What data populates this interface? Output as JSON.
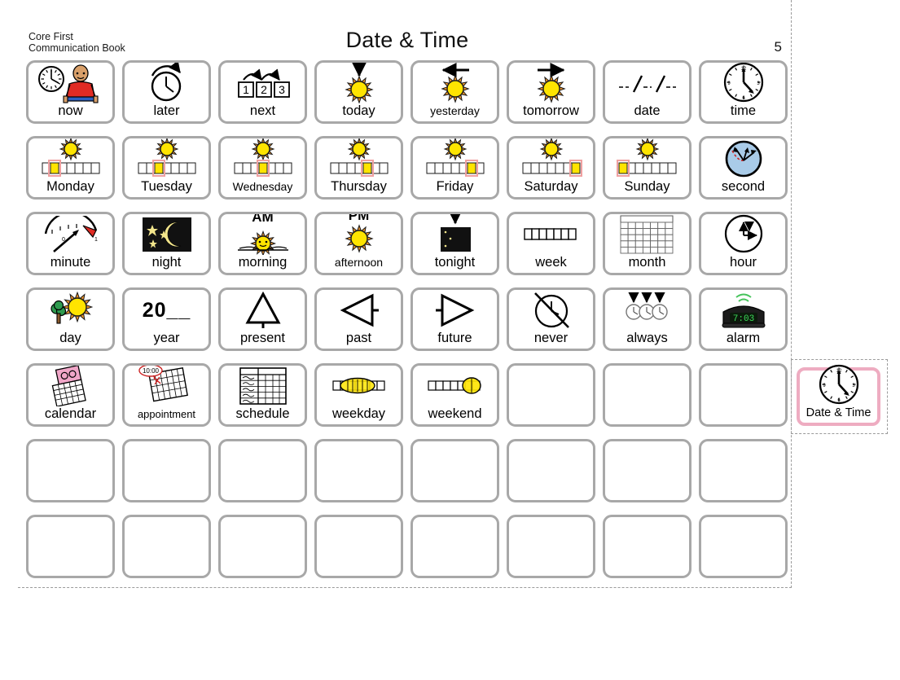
{
  "header": {
    "book_label": "Core First\nCommunication Book",
    "title": "Date & Time",
    "page_number": "5"
  },
  "tab": {
    "label": "Date & Time",
    "icon": "clock-icon",
    "border_color": "#eeacc1"
  },
  "colors": {
    "cell_border": "#a8a8a8",
    "sun_yellow": "#ffe400",
    "sun_orange": "#e8912c",
    "tab_pink": "#eeacc1",
    "second_blue": "#a9cbe8",
    "alarm_green": "#3ddc5a"
  },
  "grid": {
    "columns": 8,
    "rows": 7,
    "cells": [
      {
        "label": "now",
        "icon": "person-with-clock-icon"
      },
      {
        "label": "later",
        "icon": "clock-arrow-forward-icon"
      },
      {
        "label": "next",
        "icon": "numbered-boxes-icon",
        "numbers": [
          "1",
          "2",
          "3"
        ]
      },
      {
        "label": "today",
        "icon": "sun-down-arrow-icon"
      },
      {
        "label": "yesterday",
        "icon": "sun-left-arrow-icon"
      },
      {
        "label": "tomorrow",
        "icon": "sun-right-arrow-icon"
      },
      {
        "label": "date",
        "icon": "date-slashes-icon"
      },
      {
        "label": "time",
        "icon": "clock-face-icon"
      },
      {
        "label": "Monday",
        "icon": "week-bar-sun-icon",
        "highlight_day": 2
      },
      {
        "label": "Tuesday",
        "icon": "week-bar-sun-icon",
        "highlight_day": 3
      },
      {
        "label": "Wednesday",
        "icon": "week-bar-sun-icon",
        "highlight_day": 4
      },
      {
        "label": "Thursday",
        "icon": "week-bar-sun-icon",
        "highlight_day": 5
      },
      {
        "label": "Friday",
        "icon": "week-bar-sun-icon",
        "highlight_day": 6
      },
      {
        "label": "Saturday",
        "icon": "week-bar-sun-icon",
        "highlight_day": 7
      },
      {
        "label": "Sunday",
        "icon": "week-bar-sun-icon",
        "highlight_day": 1
      },
      {
        "label": "second",
        "icon": "second-hand-dial-icon"
      },
      {
        "label": "minute",
        "icon": "gauge-needle-icon"
      },
      {
        "label": "night",
        "icon": "moon-stars-icon"
      },
      {
        "label": "morning",
        "icon": "sunrise-icon",
        "caption": "AM"
      },
      {
        "label": "afternoon",
        "icon": "sun-icon",
        "caption": "PM"
      },
      {
        "label": "tonight",
        "icon": "moon-down-arrow-icon"
      },
      {
        "label": "week",
        "icon": "week-bar-icon"
      },
      {
        "label": "month",
        "icon": "month-grid-icon"
      },
      {
        "label": "hour",
        "icon": "hour-hand-clock-icon"
      },
      {
        "label": "day",
        "icon": "tree-sun-icon"
      },
      {
        "label": "year",
        "icon": "year-text-icon",
        "text": "20__"
      },
      {
        "label": "present",
        "icon": "up-triangle-icon"
      },
      {
        "label": "past",
        "icon": "left-triangle-icon"
      },
      {
        "label": "future",
        "icon": "right-triangle-icon"
      },
      {
        "label": "never",
        "icon": "clock-crossed-out-icon"
      },
      {
        "label": "always",
        "icon": "three-clocks-infinity-icon"
      },
      {
        "label": "alarm",
        "icon": "alarm-clock-icon",
        "display_time": "7:03"
      },
      {
        "label": "calendar",
        "icon": "calendar-icon"
      },
      {
        "label": "appointment",
        "icon": "calendar-appointment-icon",
        "bubble_time": "10:00"
      },
      {
        "label": "schedule",
        "icon": "schedule-list-icon"
      },
      {
        "label": "weekday",
        "icon": "weekday-bar-icon"
      },
      {
        "label": "weekend",
        "icon": "weekend-bar-icon"
      },
      {
        "label": "",
        "icon": ""
      },
      {
        "label": "",
        "icon": ""
      },
      {
        "label": "",
        "icon": ""
      },
      {
        "label": "",
        "icon": ""
      },
      {
        "label": "",
        "icon": ""
      },
      {
        "label": "",
        "icon": ""
      },
      {
        "label": "",
        "icon": ""
      },
      {
        "label": "",
        "icon": ""
      },
      {
        "label": "",
        "icon": ""
      },
      {
        "label": "",
        "icon": ""
      },
      {
        "label": "",
        "icon": ""
      },
      {
        "label": "",
        "icon": ""
      },
      {
        "label": "",
        "icon": ""
      },
      {
        "label": "",
        "icon": ""
      },
      {
        "label": "",
        "icon": ""
      },
      {
        "label": "",
        "icon": ""
      },
      {
        "label": "",
        "icon": ""
      },
      {
        "label": "",
        "icon": ""
      },
      {
        "label": "",
        "icon": ""
      }
    ]
  }
}
